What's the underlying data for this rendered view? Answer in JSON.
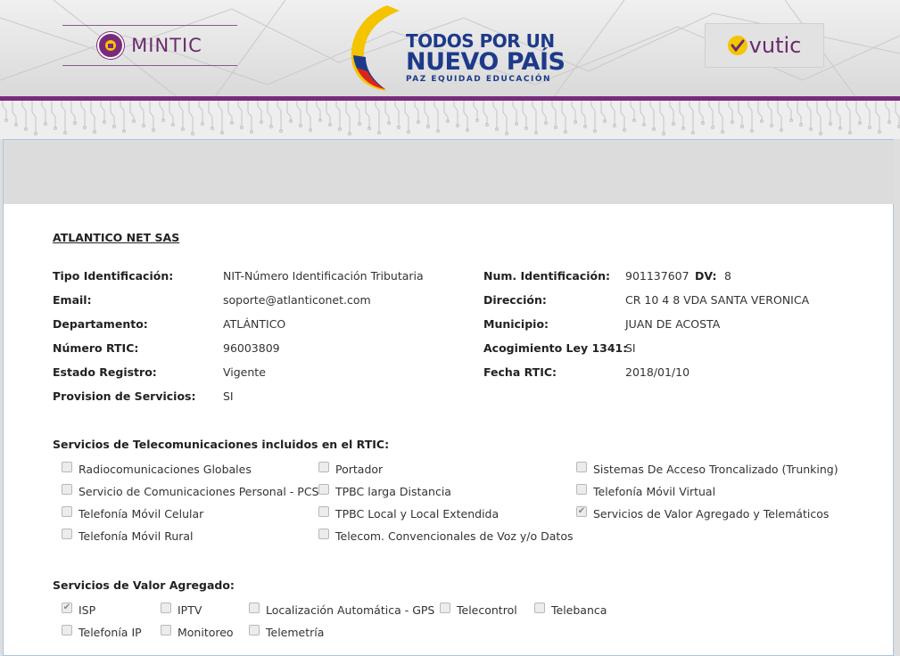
{
  "header": {
    "mintic_text": "MINTIC",
    "slogan_line1": "TODOS POR UN",
    "slogan_line2": "NUEVO PAÍS",
    "slogan_line3": "PAZ EQUIDAD EDUCACIÓN",
    "vutic_prefix": "vu",
    "vutic_suffix": "tic",
    "colors": {
      "purple": "#7a2a7c",
      "navy": "#1d3a8a",
      "yellow": "#f5c400",
      "red": "#d9261c"
    }
  },
  "company": {
    "name": "ATLANTICO NET SAS"
  },
  "fields": {
    "tipo_label": "Tipo Identificación:",
    "tipo_value": "NIT-Número Identificación Tributaria",
    "email_label": "Email:",
    "email_value": "soporte@atlanticonet.com",
    "depto_label": "Departamento:",
    "depto_value": "ATLÁNTICO",
    "rtic_label": "Número RTIC:",
    "rtic_value": "96003809",
    "estado_label": "Estado Registro:",
    "estado_value": "Vigente",
    "provision_label": "Provision de Servicios:",
    "provision_value": "SI",
    "numid_label": "Num. Identificación:",
    "numid_value": "901137607",
    "dv_label": "DV:",
    "dv_value": "8",
    "direccion_label": "Dirección:",
    "direccion_value": "CR 10 4 8 VDA SANTA VERONICA",
    "municipio_label": "Municipio:",
    "municipio_value": "JUAN DE ACOSTA",
    "ley_label": "Acogimiento Ley 1341:",
    "ley_value": "SI",
    "fecha_label": "Fecha RTIC:",
    "fecha_value": "2018/01/10"
  },
  "telecom": {
    "title": "Servicios de Telecomunicaciones incluidos en el RTIC:",
    "items": [
      {
        "label": "Radiocomunicaciones Globales",
        "checked": false
      },
      {
        "label": "Servicio de Comunicaciones Personal - PCS",
        "checked": false
      },
      {
        "label": "Telefonía Móvil Celular",
        "checked": false
      },
      {
        "label": "Telefonía Móvil Rural",
        "checked": false
      },
      {
        "label": "Portador",
        "checked": false
      },
      {
        "label": "TPBC larga Distancia",
        "checked": false
      },
      {
        "label": "TPBC Local y Local Extendida",
        "checked": false
      },
      {
        "label": "Telecom. Convencionales de Voz y/o Datos",
        "checked": false
      },
      {
        "label": "Sistemas De Acceso Troncalizado (Trunking)",
        "checked": false
      },
      {
        "label": "Telefonía Móvil Virtual",
        "checked": false
      },
      {
        "label": "Servicios de Valor Agregado y Telemáticos",
        "checked": true
      }
    ]
  },
  "vas": {
    "title": "Servicios de Valor Agregado:",
    "items": [
      {
        "label": "ISP",
        "checked": true
      },
      {
        "label": "IPTV",
        "checked": false
      },
      {
        "label": "Localización Automática - GPS",
        "checked": false
      },
      {
        "label": "Telecontrol",
        "checked": false
      },
      {
        "label": "Telebanca",
        "checked": false
      },
      {
        "label": "Telefonía IP",
        "checked": false
      },
      {
        "label": "Monitoreo",
        "checked": false
      },
      {
        "label": "Telemetría",
        "checked": false
      }
    ]
  }
}
